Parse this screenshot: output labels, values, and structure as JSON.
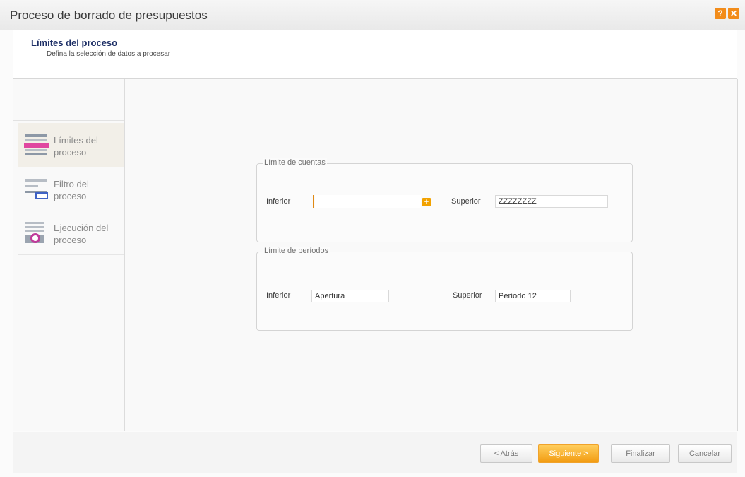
{
  "window": {
    "title": "Proceso de borrado de presupuestos",
    "help_icon": "question-icon",
    "close_icon": "close-icon",
    "accent_color": "#f28c1a"
  },
  "header": {
    "title": "Límites del proceso",
    "subtitle": "Defina la selección de datos a procesar"
  },
  "steps": [
    {
      "label": "Límites del proceso",
      "icon": "limits-icon",
      "active": true
    },
    {
      "label": "Filtro del proceso",
      "icon": "filter-icon",
      "active": false
    },
    {
      "label": "Ejecución del proceso",
      "icon": "execution-icon",
      "active": false
    }
  ],
  "cuentas": {
    "legend": "Límite de cuentas",
    "inferior_label": "Inferior",
    "inferior_value": "",
    "plus_icon": "plus-icon",
    "superior_label": "Superior",
    "superior_value": "ZZZZZZZZ"
  },
  "periodos": {
    "legend": "Límite de períodos",
    "inferior_label": "Inferior",
    "inferior_value": "Apertura",
    "superior_label": "Superior",
    "superior_value": "Período 12"
  },
  "buttons": {
    "back": "< Atrás",
    "next": "Siguiente >",
    "finish": "Finalizar",
    "cancel": "Cancelar"
  }
}
